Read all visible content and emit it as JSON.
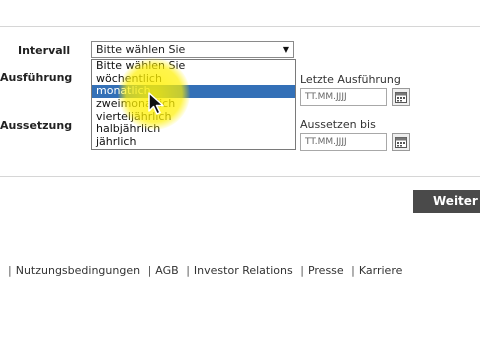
{
  "form": {
    "intervall_label": "Intervall",
    "ausfuehrung_label": "Ausführung",
    "aussetzung_label": "Aussetzung",
    "select_value": "Bitte wählen Sie",
    "options": [
      "Bitte wählen Sie",
      "wöchentlich",
      "monatlich",
      "zweimonatlich",
      "vierteljährlich",
      "halbjährlich",
      "jährlich"
    ],
    "selected_option": "monatlich",
    "letzte_ausfuehrung_label": "Letzte Ausführung",
    "letzte_ausfuehrung_value": "TT.MM.JJJJ",
    "aussetzen_bis_label": "Aussetzen bis",
    "aussetzen_bis_value": "TT.MM.JJJJ"
  },
  "next_button": "Weiter",
  "footer_links": [
    "Nutzungsbedingungen",
    "AGB",
    "Investor Relations",
    "Presse",
    "Karriere"
  ],
  "icons": {
    "calendar": "calendar-icon",
    "dropdown": "triangle-down-icon",
    "cursor": "mouse-pointer-icon"
  },
  "colors": {
    "selection": "#3370b7",
    "button": "#4a4a4a",
    "highlight": "#fff000"
  }
}
